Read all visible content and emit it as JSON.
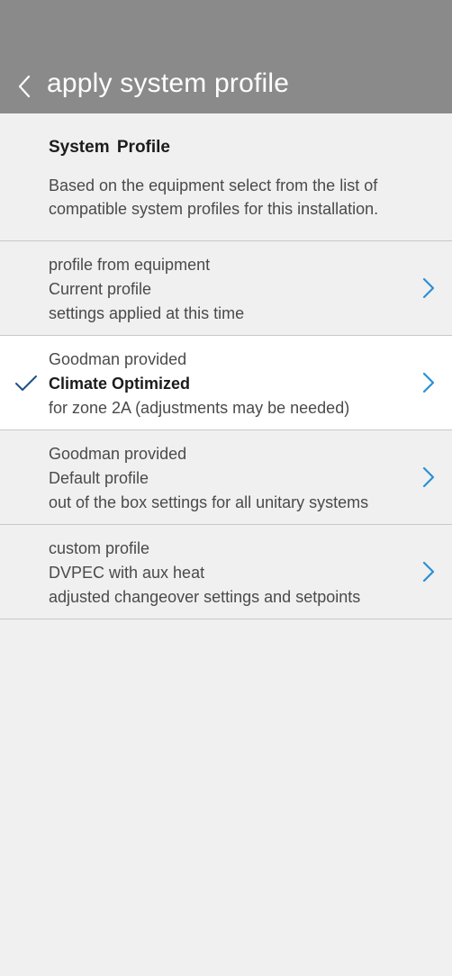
{
  "header": {
    "title": "apply system profile",
    "back_icon": "chevron-left-icon"
  },
  "section": {
    "title": "System Profile",
    "description": "Based on the equipment select from the list of compatible system profiles for this installation."
  },
  "profiles": [
    {
      "source": "profile from equipment",
      "name": "Current profile",
      "detail": "settings applied at this time",
      "selected": false
    },
    {
      "source": "Goodman provided",
      "name": "Climate Optimized",
      "detail": "for zone 2A (adjustments may be needed)",
      "selected": true
    },
    {
      "source": "Goodman provided",
      "name": "Default profile",
      "detail": "out of the box settings for all unitary systems",
      "selected": false
    },
    {
      "source": "custom profile",
      "name": "DVPEC with aux heat",
      "detail": "adjusted changeover settings and setpoints",
      "selected": false
    }
  ],
  "colors": {
    "header_bg": "#8a8a8a",
    "page_bg": "#f0f0f0",
    "selected_bg": "#ffffff",
    "accent": "#2a8fd6",
    "check": "#1f4f86"
  }
}
